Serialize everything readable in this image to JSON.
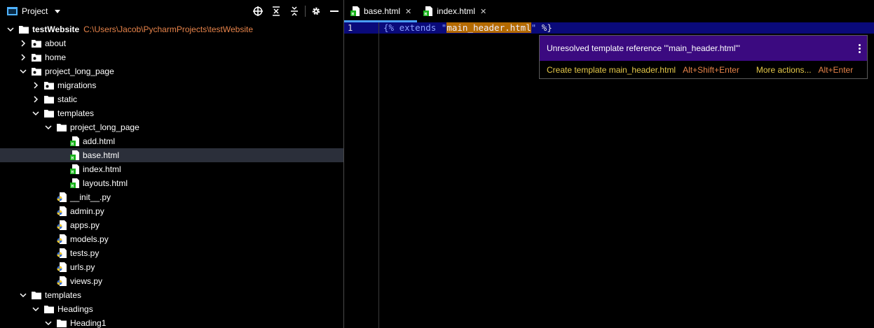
{
  "project_panel": {
    "title": "Project",
    "tools": [
      "locate-icon",
      "expand-all-icon",
      "collapse-all-icon",
      "gear-icon",
      "hide-icon"
    ]
  },
  "tree": [
    {
      "label": "testWebsite",
      "path": "C:\\Users\\Jacob\\PycharmProjects\\testWebsite",
      "type": "folder",
      "depth": 0,
      "expanded": true,
      "bold": true
    },
    {
      "label": "about",
      "type": "package",
      "depth": 1,
      "expanded": false
    },
    {
      "label": "home",
      "type": "package",
      "depth": 1,
      "expanded": false
    },
    {
      "label": "project_long_page",
      "type": "package",
      "depth": 1,
      "expanded": true
    },
    {
      "label": "migrations",
      "type": "package",
      "depth": 2,
      "expanded": false
    },
    {
      "label": "static",
      "type": "folder",
      "depth": 2,
      "expanded": false
    },
    {
      "label": "templates",
      "type": "folder",
      "depth": 2,
      "expanded": true
    },
    {
      "label": "project_long_page",
      "type": "folder",
      "depth": 3,
      "expanded": true
    },
    {
      "label": "add.html",
      "type": "html",
      "depth": 4
    },
    {
      "label": "base.html",
      "type": "html",
      "depth": 4,
      "selected": true
    },
    {
      "label": "index.html",
      "type": "html",
      "depth": 4
    },
    {
      "label": "layouts.html",
      "type": "html",
      "depth": 4
    },
    {
      "label": "__init__.py",
      "type": "python",
      "depth": 3
    },
    {
      "label": "admin.py",
      "type": "python",
      "depth": 3
    },
    {
      "label": "apps.py",
      "type": "python",
      "depth": 3
    },
    {
      "label": "models.py",
      "type": "python",
      "depth": 3
    },
    {
      "label": "tests.py",
      "type": "python",
      "depth": 3
    },
    {
      "label": "urls.py",
      "type": "python",
      "depth": 3
    },
    {
      "label": "views.py",
      "type": "python",
      "depth": 3
    },
    {
      "label": "templates",
      "type": "folder",
      "depth": 1,
      "expanded": true
    },
    {
      "label": "Headings",
      "type": "folder",
      "depth": 2,
      "expanded": true
    },
    {
      "label": "Heading1",
      "type": "folder",
      "depth": 3,
      "expanded": true
    }
  ],
  "tabs": [
    {
      "label": "base.html",
      "active": true
    },
    {
      "label": "index.html",
      "active": false
    }
  ],
  "editor": {
    "line_number": "1",
    "code": {
      "open": "{%",
      "keyword": " extends ",
      "quote_open": "\"",
      "highlighted": "main_header.html",
      "quote_close": "\"",
      "close": " %}"
    }
  },
  "popup": {
    "message": "Unresolved template reference '\"main_header.html\"'",
    "action1": "Create template main_header.html",
    "action1_shortcut": "Alt+Shift+Enter",
    "action2": "More actions...",
    "action2_shortcut": "Alt+Enter"
  },
  "colors": {
    "accent": "#4a9eff",
    "popup_header": "#3b0a80",
    "path": "#e6834a",
    "action": "#e6c94a",
    "highlight": "#b46a00",
    "line_highlight": "#0a0a7a"
  }
}
